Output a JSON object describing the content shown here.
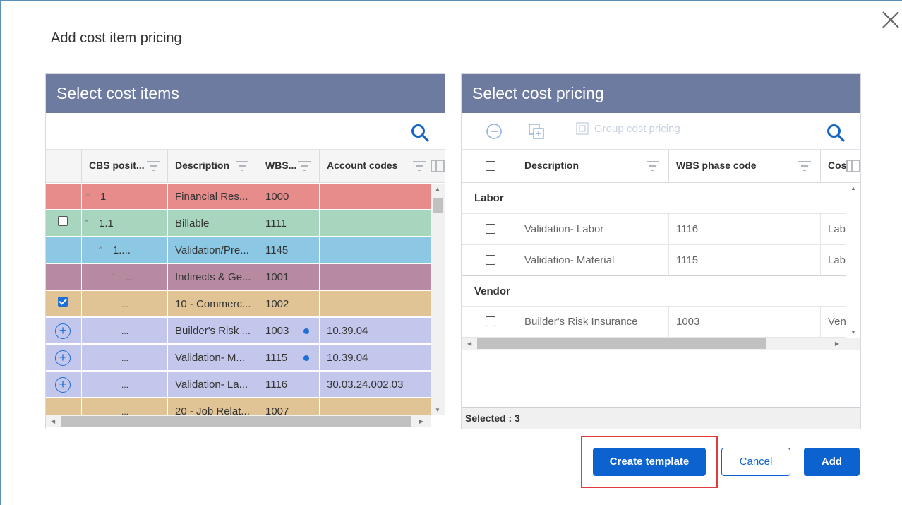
{
  "dialog": {
    "title": "Add cost item pricing",
    "close_icon": "close-icon"
  },
  "left_panel": {
    "header": "Select cost items",
    "columns": [
      "CBS posit...",
      "Description",
      "WBS...",
      "Account codes"
    ],
    "rows": [
      {
        "cbs": "1",
        "caret": "^",
        "description": "Financial Res...",
        "wbs": "1000",
        "account": "",
        "color": "#e88b8b",
        "control": "none"
      },
      {
        "cbs": "1.1",
        "caret": "^",
        "description": "Billable",
        "wbs": "1111",
        "account": "",
        "color": "#a8d5be",
        "control": "checkbox"
      },
      {
        "cbs": "1....",
        "caret": "^",
        "description": "Validation/Pre...",
        "wbs": "1145",
        "account": "",
        "color": "#8cc7e3",
        "control": "none"
      },
      {
        "cbs": "...",
        "caret": "^",
        "description": "Indirects & Ge...",
        "wbs": "1001",
        "account": "",
        "color": "#b88aa2",
        "control": "none"
      },
      {
        "cbs": "...",
        "caret": "",
        "description": "10 - Commerc...",
        "wbs": "1002",
        "account": "",
        "color": "#e0c496",
        "control": "checkbox-checked"
      },
      {
        "cbs": "...",
        "caret": "",
        "description": "Builder's Risk ...",
        "wbs": "1003",
        "account": "10.39.04",
        "color": "#c4c7ec",
        "control": "plus",
        "dot": true
      },
      {
        "cbs": "...",
        "caret": "",
        "description": "Validation- M...",
        "wbs": "1115",
        "account": "10.39.04",
        "color": "#c4c7ec",
        "control": "plus",
        "dot": true
      },
      {
        "cbs": "...",
        "caret": "",
        "description": "Validation- La...",
        "wbs": "1116",
        "account": "30.03.24.002.03",
        "color": "#c4c7ec",
        "control": "plus",
        "dot": false
      },
      {
        "cbs": "...",
        "caret": "",
        "description": "20 - Job Relat...",
        "wbs": "1007",
        "account": "",
        "color": "#e0c496",
        "control": "none"
      }
    ]
  },
  "right_panel": {
    "header": "Select cost pricing",
    "toolbar": {
      "group_label": "Group cost pricing"
    },
    "columns": [
      "Description",
      "WBS phase code",
      "Cos"
    ],
    "groups": [
      {
        "name": "Labor",
        "rows": [
          {
            "description": "Validation- Labor",
            "wbs": "1116",
            "cost": "Lab"
          },
          {
            "description": "Validation- Material",
            "wbs": "1115",
            "cost": "Lab"
          }
        ]
      },
      {
        "name": "Vendor",
        "rows": [
          {
            "description": "Builder's Risk Insurance",
            "wbs": "1003",
            "cost": "Ven"
          }
        ]
      }
    ],
    "status": "Selected : 3"
  },
  "buttons": {
    "create_template": "Create template",
    "cancel": "Cancel",
    "add": "Add"
  },
  "colors": {
    "accent": "#0c63cf",
    "header_bg": "#6e7ba1",
    "highlight": "#e23b3b"
  }
}
